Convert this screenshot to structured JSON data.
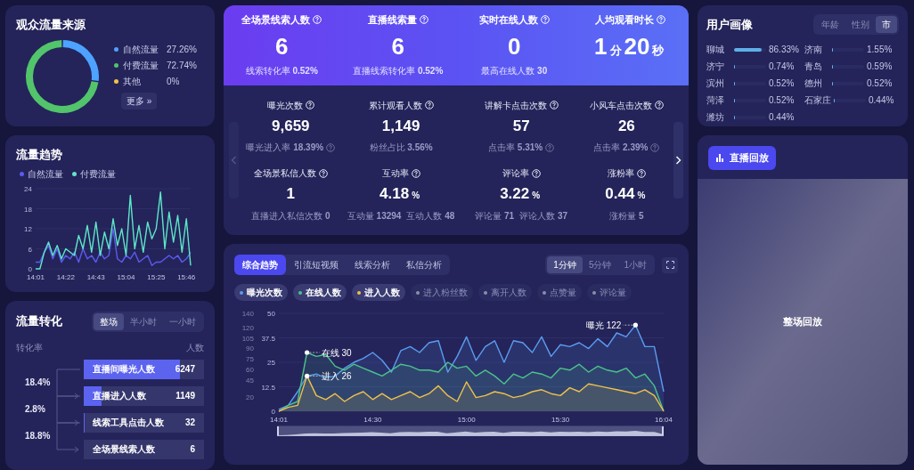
{
  "source": {
    "title": "观众流量来源",
    "chart_data": {
      "type": "donut",
      "categories": [
        "自然流量",
        "付费流量",
        "其他"
      ],
      "values": [
        27.26,
        72.74,
        0
      ]
    },
    "legend": [
      {
        "value": "27.26%",
        "color": "#4da3ff"
      },
      {
        "value": "72.74%",
        "color": "#52c46b"
      },
      {
        "value": "0%",
        "color": "#f5c342"
      }
    ],
    "more_button": "更多 »"
  },
  "trend": {
    "title": "流量趋势",
    "chart_data": {
      "type": "line",
      "grid": true,
      "ylim": [
        0,
        24
      ],
      "yticks": [
        0,
        6,
        12,
        18,
        24
      ],
      "categories": [
        "14:01",
        null,
        null,
        null,
        null,
        null,
        null,
        "14:22",
        null,
        null,
        null,
        null,
        null,
        null,
        "14:43",
        null,
        null,
        null,
        null,
        null,
        null,
        "15:04",
        null,
        null,
        null,
        null,
        null,
        null,
        "15:25",
        null,
        null,
        null,
        null,
        null,
        null,
        "15:46",
        null
      ],
      "series": [
        {
          "name": "自然流量",
          "color": "#5b5bf0",
          "values": [
            2,
            2,
            5,
            7,
            3,
            6,
            2,
            4,
            3,
            5,
            2,
            6,
            3,
            4,
            2,
            5,
            3,
            4,
            12,
            3,
            2,
            4,
            3,
            5,
            2,
            3,
            4,
            1,
            2,
            2,
            3,
            4,
            3,
            4,
            2,
            3,
            5
          ]
        },
        {
          "name": "付费流量",
          "color": "#5ee6c8",
          "values": [
            0,
            0,
            5,
            8,
            4,
            7,
            3,
            6,
            5,
            4,
            10,
            6,
            13,
            5,
            14,
            4,
            11,
            6,
            15,
            7,
            12,
            4,
            22,
            6,
            13,
            5,
            14,
            9,
            12,
            23,
            6,
            17,
            8,
            16,
            5,
            15,
            1
          ]
        }
      ]
    }
  },
  "conversion": {
    "title": "流量转化",
    "tabs": [
      {
        "label": "整场",
        "selected": true
      },
      {
        "label": "半小时",
        "selected": false
      },
      {
        "label": "一小时",
        "selected": false
      }
    ],
    "rate_header": "转化率",
    "count_header": "人数",
    "steps": [
      {
        "label": "直播间曝光人数",
        "value": "6247",
        "level": 0.8
      },
      {
        "label": "直播进入人数",
        "value": "1149",
        "level": 0.15
      },
      {
        "label": "线索工具点击人数",
        "value": "32",
        "level": 0.01
      },
      {
        "label": "全场景线索人数",
        "value": "6",
        "level": 0
      }
    ],
    "rates": [
      "18.4%",
      "2.8%",
      "18.8%"
    ]
  },
  "kpis": [
    {
      "title": "全场景线索人数",
      "value": [
        {
          "text": "6",
          "kind": "number"
        }
      ],
      "sub": "线索转化率 **0.52%**"
    },
    {
      "title": "直播线索量",
      "value": [
        {
          "text": "6",
          "kind": "number"
        }
      ],
      "sub": "直播线索转化率 **0.52%**"
    },
    {
      "title": "实时在线人数",
      "value": [
        {
          "text": "0",
          "kind": "number"
        }
      ],
      "sub": "最高在线人数 **30**"
    },
    {
      "title": "人均观看时长",
      "value": [
        {
          "text": "1",
          "kind": "number"
        },
        {
          "text": "分",
          "kind": "unit"
        },
        {
          "text": "20",
          "kind": "number"
        },
        {
          "text": "秒",
          "kind": "unit"
        }
      ]
    }
  ],
  "carousel": {
    "prev_disabled": true,
    "next_disabled": false
  },
  "metrics": [
    {
      "title": "曝光次数",
      "value": [
        {
          "text": "9,659",
          "kind": "number"
        }
      ],
      "subs": [
        {
          "text": "曝光进入率 **18.39%**",
          "hint": true
        }
      ]
    },
    {
      "title": "累计观看人数",
      "value": [
        {
          "text": "1,149",
          "kind": "number"
        }
      ],
      "subs": [
        {
          "text": "粉丝占比 **3.56%**",
          "hint": false
        }
      ]
    },
    {
      "title": "讲解卡点击次数",
      "value": [
        {
          "text": "57",
          "kind": "number"
        }
      ],
      "subs": [
        {
          "text": "点击率 **5.31%**",
          "hint": true
        }
      ]
    },
    {
      "title": "小风车点击次数",
      "value": [
        {
          "text": "26",
          "kind": "number"
        }
      ],
      "subs": [
        {
          "text": "点击率 **2.39%**",
          "hint": true
        }
      ]
    },
    {
      "title": "全场景私信人数",
      "value": [
        {
          "text": "1",
          "kind": "number"
        }
      ],
      "subs": [
        {
          "text": "直播进入私信次数 **0**",
          "hint": false
        }
      ]
    },
    {
      "title": "互动率",
      "value": [
        {
          "text": "4.18",
          "kind": "number"
        },
        {
          "text": "%",
          "kind": "unit"
        }
      ],
      "subs": [
        {
          "text": "互动量 **13294**",
          "hint": false
        },
        {
          "text": "互动人数 **48**",
          "hint": false
        }
      ]
    },
    {
      "title": "评论率",
      "value": [
        {
          "text": "3.22",
          "kind": "number"
        },
        {
          "text": "%",
          "kind": "unit"
        }
      ],
      "subs": [
        {
          "text": "评论量 **71**",
          "hint": false
        },
        {
          "text": "评论人数 **37**",
          "hint": false
        }
      ]
    },
    {
      "title": "涨粉率",
      "value": [
        {
          "text": "0.44",
          "kind": "number"
        },
        {
          "text": "%",
          "kind": "unit"
        }
      ],
      "subs": [
        {
          "text": "涨粉量 **5**",
          "hint": false
        }
      ]
    }
  ],
  "analysis": {
    "tabs": [
      {
        "label": "综合趋势",
        "selected": true
      },
      {
        "label": "引流短视频",
        "selected": false
      },
      {
        "label": "线索分析",
        "selected": false
      },
      {
        "label": "私信分析",
        "selected": false
      }
    ],
    "intervals": [
      {
        "label": "1分钟",
        "selected": true
      },
      {
        "label": "5分钟",
        "selected": false
      },
      {
        "label": "1小时",
        "selected": false
      }
    ],
    "chips": [
      {
        "label": "曝光次数",
        "on": true,
        "color": "#5b9cf0"
      },
      {
        "label": "在线人数",
        "on": true,
        "color": "#4cc38a"
      },
      {
        "label": "进入人数",
        "on": true,
        "color": "#f0c14b"
      },
      {
        "label": "进入粉丝数",
        "on": false,
        "color": "#8b8fa8"
      },
      {
        "label": "离开人数",
        "on": false,
        "color": "#8b8fa8"
      },
      {
        "label": "点赞量",
        "on": false,
        "color": "#8b8fa8"
      },
      {
        "label": "评论量",
        "on": false,
        "color": "#8b8fa8"
      }
    ],
    "secondary_axis": [
      "140",
      "120",
      "105",
      "90",
      "75",
      "60",
      "45",
      "20"
    ],
    "range_slider": {
      "level": 1
    },
    "chart_data": {
      "type": "area",
      "grid": true,
      "ylim": [
        0,
        50
      ],
      "yticks": [
        0,
        12.5,
        25,
        37.5,
        50
      ],
      "categories": [
        "14:01",
        null,
        null,
        null,
        null,
        null,
        null,
        null,
        null,
        null,
        "14:30",
        null,
        null,
        null,
        null,
        null,
        null,
        null,
        null,
        null,
        "15:00",
        null,
        null,
        null,
        null,
        null,
        null,
        null,
        null,
        null,
        "15:30",
        null,
        null,
        null,
        null,
        null,
        null,
        null,
        null,
        null,
        null,
        "16:04"
      ],
      "series": [
        {
          "color": "#5b9cf0",
          "values": [
            1,
            3,
            10,
            18,
            19,
            17,
            18,
            22,
            25,
            27,
            30,
            26,
            20,
            31,
            33,
            30,
            35,
            36,
            20,
            28,
            38,
            26,
            33,
            36,
            25,
            36,
            35,
            30,
            38,
            28,
            34,
            33,
            35,
            32,
            37,
            33,
            40,
            38,
            44,
            33,
            33,
            10
          ]
        },
        {
          "color": "#4cc38a",
          "values": [
            0,
            3,
            5,
            30,
            28,
            29,
            23,
            21,
            24,
            22,
            20,
            18,
            21,
            24,
            23,
            21,
            21,
            20,
            25,
            22,
            23,
            18,
            21,
            18,
            14,
            19,
            17,
            20,
            19,
            17,
            22,
            21,
            24,
            20,
            23,
            21,
            20,
            22,
            17,
            19,
            13,
            0
          ]
        },
        {
          "color": "#f0c14b",
          "values": [
            0,
            2,
            3,
            18,
            8,
            6,
            9,
            5,
            8,
            10,
            6,
            9,
            6,
            8,
            10,
            7,
            9,
            13,
            8,
            5,
            15,
            7,
            8,
            10,
            9,
            7,
            8,
            10,
            11,
            9,
            8,
            12,
            10,
            14,
            13,
            12,
            11,
            10,
            9,
            11,
            8,
            0
          ]
        }
      ],
      "annotations": [
        "曝光 122",
        "在线 30",
        "进入 26"
      ]
    }
  },
  "profile": {
    "title": "用户画像",
    "tabs": [
      {
        "label": "年龄",
        "selected": false
      },
      {
        "label": "性别",
        "selected": false
      },
      {
        "label": "市",
        "selected": true
      }
    ],
    "cities": [
      {
        "name": "聊城",
        "value": "86.33%",
        "level": 0.8633
      },
      {
        "name": "济南",
        "value": "1.55%",
        "level": 0.03
      },
      {
        "name": "济宁",
        "value": "0.74%",
        "level": 0.03
      },
      {
        "name": "青岛",
        "value": "0.59%",
        "level": 0.03
      },
      {
        "name": "滨州",
        "value": "0.52%",
        "level": 0.03
      },
      {
        "name": "德州",
        "value": "0.52%",
        "level": 0.03
      },
      {
        "name": "菏泽",
        "value": "0.52%",
        "level": 0.03
      },
      {
        "name": "石家庄",
        "value": "0.44%",
        "level": 0.03
      },
      {
        "name": "潍坊",
        "value": "0.44%",
        "level": 0.03
      }
    ]
  },
  "replay": {
    "button": "直播回放",
    "video_label": "整场回放"
  }
}
